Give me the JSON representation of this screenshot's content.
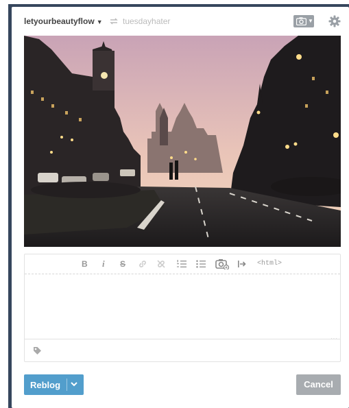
{
  "header": {
    "blog_name": "letyourbeautyflow",
    "source_blog": "tuesdayhater"
  },
  "editor": {
    "toolbar": {
      "bold": "B",
      "italic": "i",
      "strike": "S",
      "html": "<html>"
    },
    "icons": [
      "link-icon",
      "unlink-icon",
      "ordered-list-icon",
      "unordered-list-icon",
      "insert-image-icon",
      "read-more-icon"
    ]
  },
  "actions": {
    "reblog_label": "Reblog",
    "cancel_label": "Cancel"
  },
  "colors": {
    "frame": "#36465d",
    "reblog_button": "#529ecc",
    "cancel_button": "#a8acb0"
  }
}
